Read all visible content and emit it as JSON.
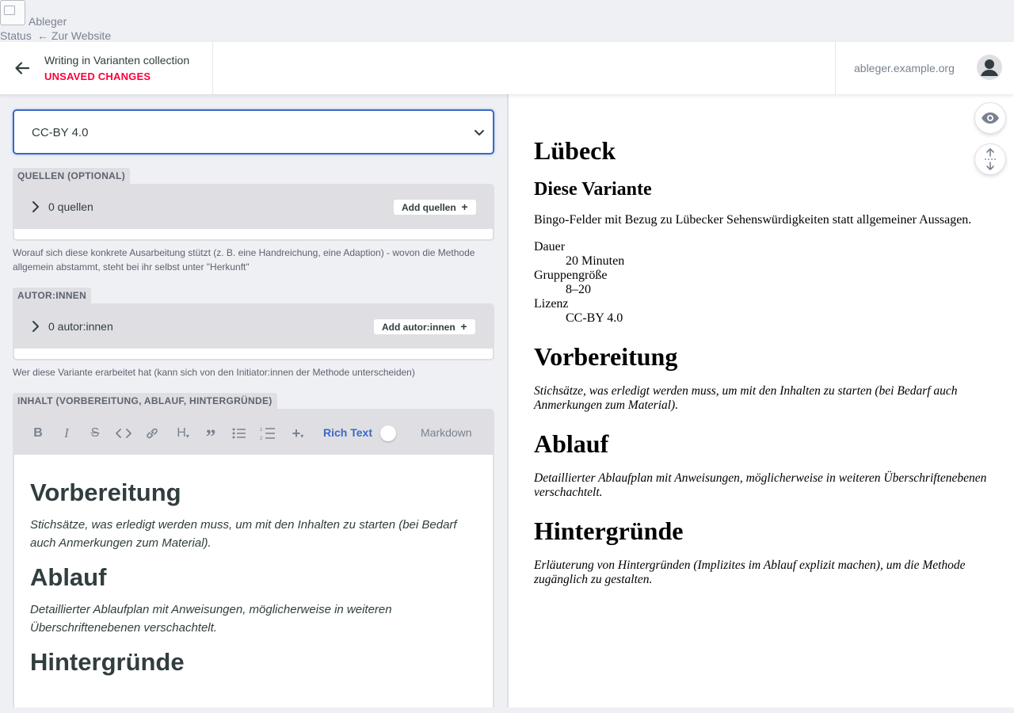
{
  "topbar": {
    "site_name": "Ableger",
    "status_link": "Status",
    "site_link": "← Zur Website"
  },
  "header": {
    "entry_title": "Writing in Varianten collection",
    "unsaved": "UNSAVED CHANGES",
    "domain": "ableger.example.org"
  },
  "editor": {
    "license_value": "CC-BY 4.0",
    "quellen": {
      "label": "QUELLEN (OPTIONAL)",
      "count": "0 quellen",
      "add": "Add quellen",
      "hint": "Worauf sich diese konkrete Ausarbeitung stützt (z. B. eine Handreichung, eine Adaption) - wovon die Methode allgemein abstammt, steht bei ihr selbst unter \"Herkunft\""
    },
    "autoren": {
      "label": "AUTOR:INNEN",
      "count": "0 autor:innen",
      "add": "Add autor:innen",
      "hint": "Wer diese Variante erarbeitet hat (kann sich von den Initiator:innen der Methode unterscheiden)"
    },
    "inhalt": {
      "label": "INHALT (VORBEREITUNG, ABLAUF, HINTERGRÜNDE)",
      "mode_rich": "Rich Text",
      "mode_md": "Markdown",
      "blocks": [
        {
          "h": "Vorbereitung",
          "p": "Stichsätze, was erledigt werden muss, um mit den Inhalten zu starten (bei Bedarf auch Anmerkungen zum Material)."
        },
        {
          "h": "Ablauf",
          "p": "Detaillierter Ablaufplan mit Anweisungen, möglicherweise in weiteren Überschriftenebenen verschachtelt."
        },
        {
          "h": "Hintergründe",
          "p": ""
        }
      ]
    }
  },
  "preview": {
    "title": "Lübeck",
    "subtitle": "Diese Variante",
    "description": "Bingo-Felder mit Bezug zu Lübecker Sehenswürdigkeiten statt allgemeiner Aussagen.",
    "meta": [
      {
        "term": "Dauer",
        "value": "20 Minuten"
      },
      {
        "term": "Gruppengröße",
        "value": "8–20"
      },
      {
        "term": "Lizenz",
        "value": "CC-BY 4.0"
      }
    ],
    "sections": [
      {
        "h": "Vorbereitung",
        "p": "Stichsätze, was erledigt werden muss, um mit den Inhalten zu starten (bei Bedarf auch Anmerkungen zum Material)."
      },
      {
        "h": "Ablauf",
        "p": "Detaillierter Ablaufplan mit Anweisungen, möglicherweise in weiteren Überschriftenebenen verschachtelt."
      },
      {
        "h": "Hintergründe",
        "p": "Erläuterung von Hintergründen (Implizites im Ablauf explizit machen), um die Methode zugänglich zu gestalten."
      }
    ]
  },
  "colors": {
    "accent": "#3a69c7",
    "unsaved": "#ff003b",
    "toolbar_bg": "#dfdfe3"
  }
}
